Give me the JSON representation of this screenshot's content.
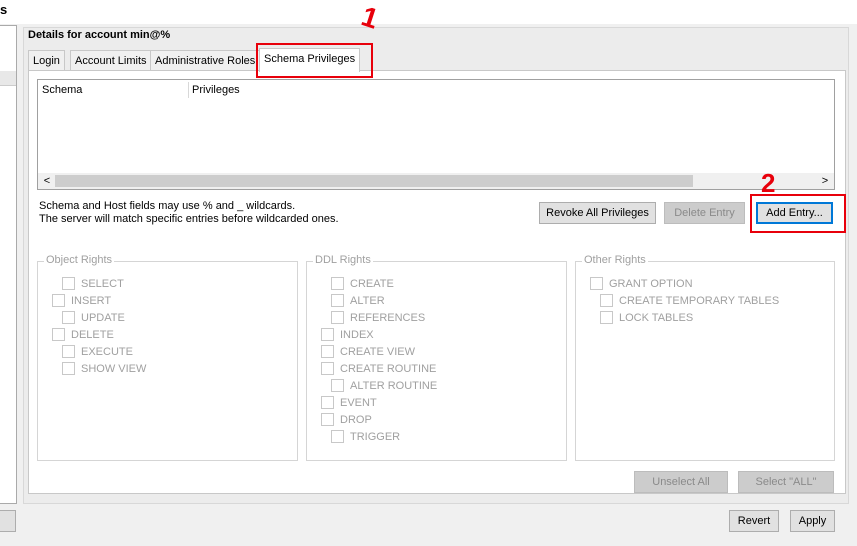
{
  "page": {
    "corner_text": "s",
    "account_title": "Details for account min@%"
  },
  "tabs": [
    {
      "label": "Login"
    },
    {
      "label": "Account Limits"
    },
    {
      "label": "Administrative Roles"
    },
    {
      "label": "Schema Privileges"
    }
  ],
  "table": {
    "columns": [
      "Schema",
      "Privileges"
    ]
  },
  "info": {
    "line1": "Schema and Host fields may use % and _ wildcards.",
    "line2": "The server will match specific entries before wildcarded ones."
  },
  "buttons": {
    "revoke": "Revoke All Privileges",
    "delete": "Delete Entry",
    "add": "Add Entry...",
    "unselect": "Unselect All",
    "select_all": "Select \"ALL\"",
    "revert": "Revert",
    "apply": "Apply"
  },
  "object_rights": {
    "title": "Object Rights",
    "items": [
      "SELECT",
      "INSERT",
      "UPDATE",
      "DELETE",
      "EXECUTE",
      "SHOW VIEW"
    ]
  },
  "ddl_rights": {
    "title": "DDL Rights",
    "items": [
      "CREATE",
      "ALTER",
      "REFERENCES",
      "INDEX",
      "CREATE VIEW",
      "CREATE ROUTINE",
      "ALTER ROUTINE",
      "EVENT",
      "DROP",
      "TRIGGER"
    ]
  },
  "other_rights": {
    "title": "Other Rights",
    "items": [
      "GRANT OPTION",
      "CREATE TEMPORARY TABLES",
      "LOCK TABLES"
    ]
  },
  "annotations": {
    "one": "1",
    "two": "2"
  },
  "colors": {
    "annotation": "#e8000b",
    "focus": "#0078d7"
  }
}
